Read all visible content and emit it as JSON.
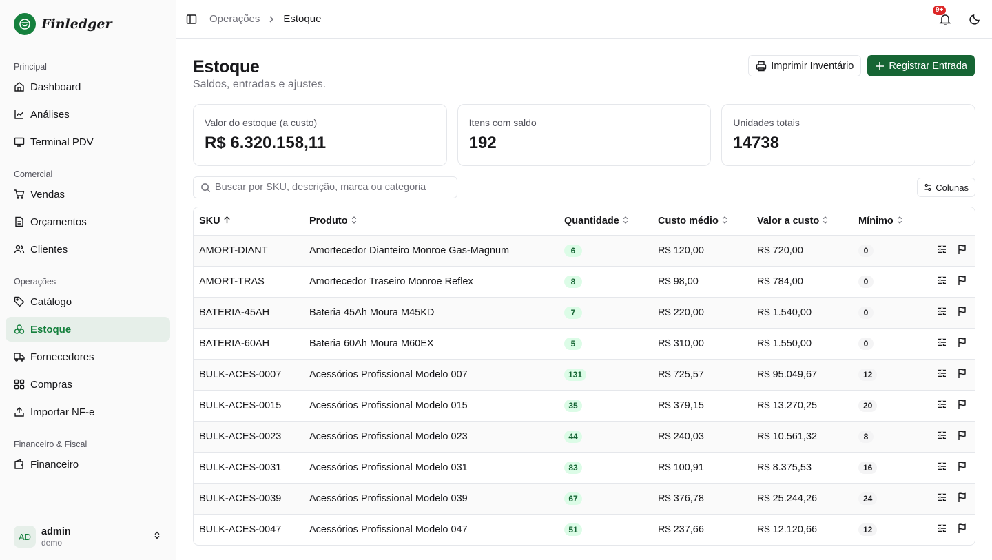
{
  "brand": {
    "name": "Finledger"
  },
  "sidebar": {
    "groups": [
      {
        "label": "Principal",
        "items": [
          {
            "label": "Dashboard",
            "icon": "home-icon"
          },
          {
            "label": "Análises",
            "icon": "chart-line-icon"
          },
          {
            "label": "Terminal PDV",
            "icon": "monitor-icon"
          }
        ]
      },
      {
        "label": "Comercial",
        "items": [
          {
            "label": "Vendas",
            "icon": "cart-icon"
          },
          {
            "label": "Orçamentos",
            "icon": "file-text-icon"
          },
          {
            "label": "Clientes",
            "icon": "users-icon"
          }
        ]
      },
      {
        "label": "Operações",
        "items": [
          {
            "label": "Catálogo",
            "icon": "tag-icon"
          },
          {
            "label": "Estoque",
            "icon": "boxes-icon",
            "active": true
          },
          {
            "label": "Fornecedores",
            "icon": "truck-icon"
          },
          {
            "label": "Compras",
            "icon": "grid-icon"
          },
          {
            "label": "Importar NF-e",
            "icon": "upload-icon"
          }
        ]
      },
      {
        "label": "Financeiro & Fiscal",
        "items": [
          {
            "label": "Financeiro",
            "icon": "wallet-icon"
          }
        ]
      }
    ]
  },
  "user": {
    "initials": "AD",
    "name": "admin",
    "sub": "demo"
  },
  "breadcrumb": {
    "parent": "Operações",
    "current": "Estoque"
  },
  "notifications": {
    "count": "9+"
  },
  "colors": {
    "brand": "#15803d",
    "primary_button": "#166534",
    "badge_red": "#dc2626",
    "qty_bg": "#dcfce7"
  },
  "page": {
    "title": "Estoque",
    "subtitle": "Saldos, entradas e ajustes."
  },
  "actions": {
    "print": "Imprimir Inventário",
    "register": "Registrar Entrada"
  },
  "stats": [
    {
      "label": "Valor do estoque (a custo)",
      "value": "R$ 6.320.158,11"
    },
    {
      "label": "Itens com saldo",
      "value": "192"
    },
    {
      "label": "Unidades totais",
      "value": "14738"
    }
  ],
  "search": {
    "placeholder": "Buscar por SKU, descrição, marca ou categoria",
    "value": ""
  },
  "columns_button": "Colunas",
  "table": {
    "headers": [
      "SKU",
      "Produto",
      "Quantidade",
      "Custo médio",
      "Valor a custo",
      "Mínimo"
    ],
    "rows": [
      {
        "sku": "AMORT-DIANT",
        "produto": "Amortecedor Dianteiro Monroe Gas-Magnum",
        "qtd": "6",
        "custo": "R$ 120,00",
        "valor": "R$ 720,00",
        "minimo": "0"
      },
      {
        "sku": "AMORT-TRAS",
        "produto": "Amortecedor Traseiro Monroe Reflex",
        "qtd": "8",
        "custo": "R$ 98,00",
        "valor": "R$ 784,00",
        "minimo": "0"
      },
      {
        "sku": "BATERIA-45AH",
        "produto": "Bateria 45Ah Moura M45KD",
        "qtd": "7",
        "custo": "R$ 220,00",
        "valor": "R$ 1.540,00",
        "minimo": "0"
      },
      {
        "sku": "BATERIA-60AH",
        "produto": "Bateria 60Ah Moura M60EX",
        "qtd": "5",
        "custo": "R$ 310,00",
        "valor": "R$ 1.550,00",
        "minimo": "0"
      },
      {
        "sku": "BULK-ACES-0007",
        "produto": "Acessórios Profissional Modelo 007",
        "qtd": "131",
        "custo": "R$ 725,57",
        "valor": "R$ 95.049,67",
        "minimo": "12"
      },
      {
        "sku": "BULK-ACES-0015",
        "produto": "Acessórios Profissional Modelo 015",
        "qtd": "35",
        "custo": "R$ 379,15",
        "valor": "R$ 13.270,25",
        "minimo": "20"
      },
      {
        "sku": "BULK-ACES-0023",
        "produto": "Acessórios Profissional Modelo 023",
        "qtd": "44",
        "custo": "R$ 240,03",
        "valor": "R$ 10.561,32",
        "minimo": "8"
      },
      {
        "sku": "BULK-ACES-0031",
        "produto": "Acessórios Profissional Modelo 031",
        "qtd": "83",
        "custo": "R$ 100,91",
        "valor": "R$ 8.375,53",
        "minimo": "16"
      },
      {
        "sku": "BULK-ACES-0039",
        "produto": "Acessórios Profissional Modelo 039",
        "qtd": "67",
        "custo": "R$ 376,78",
        "valor": "R$ 25.244,26",
        "minimo": "24"
      },
      {
        "sku": "BULK-ACES-0047",
        "produto": "Acessórios Profissional Modelo 047",
        "qtd": "51",
        "custo": "R$ 237,66",
        "valor": "R$ 12.120,66",
        "minimo": "12"
      }
    ]
  }
}
